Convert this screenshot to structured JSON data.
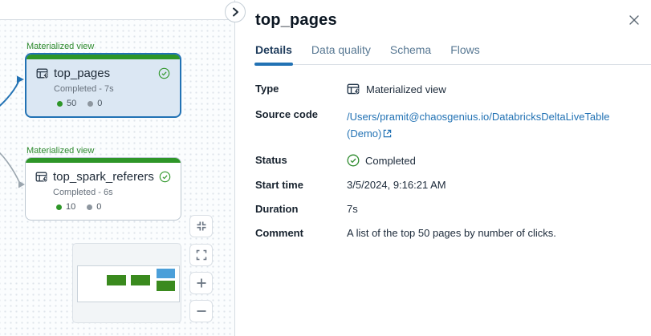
{
  "colors": {
    "accent_blue": "#2272B4",
    "status_green": "#2E9628",
    "link_blue": "#2272B4",
    "edge_gray": "#9AA5AE",
    "minimap_node_green": "#3A8A1E",
    "minimap_node_blue": "#4B9FD9"
  },
  "canvas": {
    "nodes": [
      {
        "type_label": "Materialized view",
        "name": "top_pages",
        "status": "Completed - 7s",
        "records_written": "50",
        "records_dropped": "0"
      },
      {
        "type_label": "Materialized view",
        "name": "top_spark_referers",
        "status": "Completed - 6s",
        "records_written": "10",
        "records_dropped": "0"
      }
    ]
  },
  "panel": {
    "title": "top_pages",
    "tabs": [
      {
        "label": "Details"
      },
      {
        "label": "Data quality"
      },
      {
        "label": "Schema"
      },
      {
        "label": "Flows"
      }
    ],
    "details": [
      {
        "label": "Type",
        "value": "Materialized view"
      },
      {
        "label": "Source code",
        "value": "/Users/pramit@chaosgenius.io/DatabricksDeltaLiveTable (Demo)"
      },
      {
        "label": "Status",
        "value": "Completed"
      },
      {
        "label": "Start time",
        "value": "3/5/2024, 9:16:21 AM"
      },
      {
        "label": "Duration",
        "value": "7s"
      },
      {
        "label": "Comment",
        "value": "A list of the top 50 pages by number of clicks."
      }
    ]
  }
}
